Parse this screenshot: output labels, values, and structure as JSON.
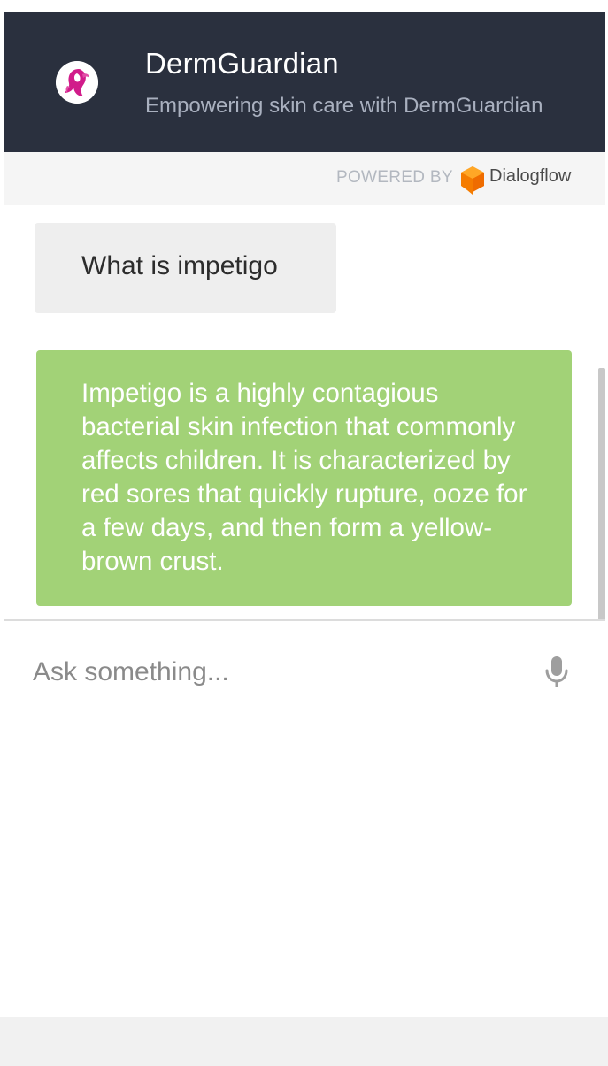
{
  "header": {
    "title": "DermGuardian",
    "subtitle": "Empowering skin care with DermGuardian",
    "avatar_icon": "woman-silhouette-logo-icon",
    "background_color": "#2a303e"
  },
  "powered_by": {
    "label": "POWERED BY",
    "brand": "Dialogflow",
    "brand_icon": "dialogflow-logo-icon"
  },
  "messages": [
    {
      "role": "user",
      "text": "What is impetigo"
    },
    {
      "role": "bot",
      "text": "Impetigo is a highly contagious bacterial skin infection that commonly affects children. It is characterized by red sores that quickly rupture, ooze for a few days, and then form a yellow-brown crust."
    }
  ],
  "input": {
    "value": "",
    "placeholder": "Ask something...",
    "mic_icon": "microphone-icon"
  },
  "colors": {
    "bot_bubble": "#a2d277",
    "user_bubble": "#eeeeee"
  }
}
